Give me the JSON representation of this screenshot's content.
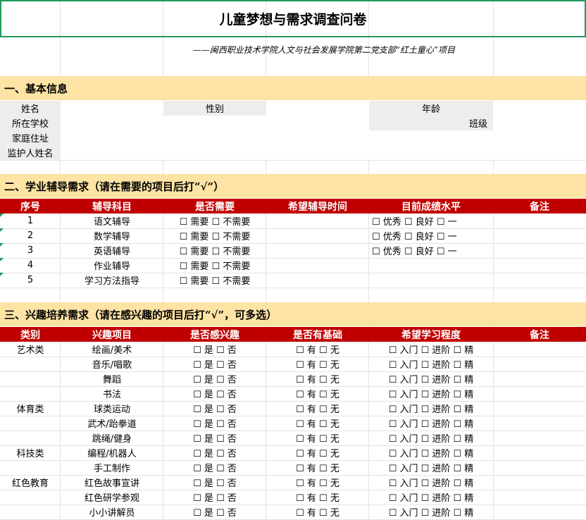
{
  "title": "儿童梦想与需求调查问卷",
  "subtitle": "——闽西职业技术学院人文与社会发展学院第二党支部“红土童心”项目",
  "section1": {
    "heading": "一、基本信息",
    "name_label": "姓名",
    "gender_label": "性别",
    "age_label": "年龄",
    "school_label": "所在学校",
    "class_label": "班级",
    "address_label": "家庭住址",
    "guardian_label": "监护人姓名"
  },
  "section2": {
    "heading": "二、学业辅导需求（请在需要的项目后打“√”）",
    "headers": [
      "序号",
      "辅导科目",
      "是否需要",
      "希望辅导时间",
      "目前成绩水平",
      "备注"
    ],
    "rows": [
      {
        "no": "1",
        "subject": "语文辅导",
        "need": "☐ 需要 ☐ 不需要",
        "level": "☐ 优秀 ☐ 良好 ☐ 一"
      },
      {
        "no": "2",
        "subject": "数学辅导",
        "need": "☐ 需要 ☐ 不需要",
        "level": "☐ 优秀 ☐ 良好 ☐ 一"
      },
      {
        "no": "3",
        "subject": "英语辅导",
        "need": "☐ 需要 ☐ 不需要",
        "level": "☐ 优秀 ☐ 良好 ☐ 一"
      },
      {
        "no": "4",
        "subject": "作业辅导",
        "need": "☐ 需要 ☐ 不需要",
        "level": ""
      },
      {
        "no": "5",
        "subject": "学习方法指导",
        "need": "☐ 需要 ☐ 不需要",
        "level": ""
      }
    ]
  },
  "section3": {
    "heading": "三、兴趣培养需求（请在感兴趣的项目后打“√”，可多选）",
    "headers": [
      "类别",
      "兴趣项目",
      "是否感兴趣",
      "是否有基础",
      "希望学习程度",
      "备注"
    ],
    "interest_opt": "☐ 是 ☐ 否",
    "basis_opt": "☐ 有 ☐ 无",
    "degree_opt": "☐ 入门 ☐ 进阶 ☐ 精",
    "rows": [
      {
        "category": "艺术类",
        "item": "绘画/美术"
      },
      {
        "category": "",
        "item": "音乐/唱歌"
      },
      {
        "category": "",
        "item": "舞蹈"
      },
      {
        "category": "",
        "item": "书法"
      },
      {
        "category": "体育类",
        "item": "球类运动"
      },
      {
        "category": "",
        "item": "武术/跆拳道"
      },
      {
        "category": "",
        "item": "跳绳/健身"
      },
      {
        "category": "科技类",
        "item": "编程/机器人"
      },
      {
        "category": "",
        "item": "手工制作"
      },
      {
        "category": "红色教育",
        "item": "红色故事宣讲"
      },
      {
        "category": "",
        "item": "红色研学参观"
      },
      {
        "category": "",
        "item": "小小讲解员"
      }
    ]
  },
  "colors": {
    "title_border": "#1e9a5c",
    "section_bg": "#fde3a4",
    "header_bg": "#c00000",
    "label_bg": "#ededed"
  }
}
